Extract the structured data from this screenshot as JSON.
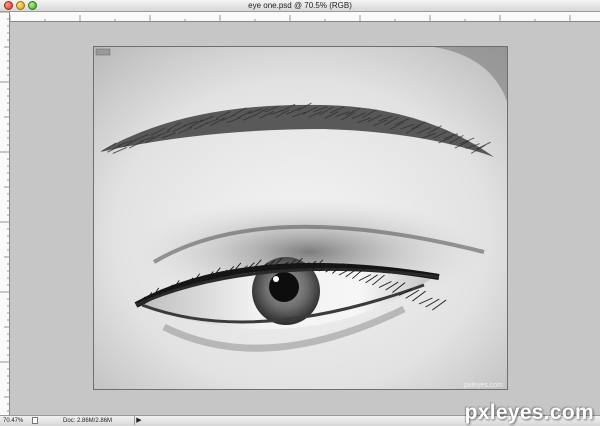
{
  "window": {
    "title": "eye one.psd @ 70.5% (RGB)"
  },
  "document": {
    "watermark": "pxleyes.com"
  },
  "status": {
    "zoom": "70.47%",
    "doc_info": "Doc: 2.86M/2.86M",
    "arrow": "▶"
  },
  "brand": {
    "text": "pxleyes.com"
  },
  "icons": [
    "close-icon",
    "minimize-icon",
    "zoom-icon",
    "document-icon",
    "play-arrow-icon"
  ]
}
